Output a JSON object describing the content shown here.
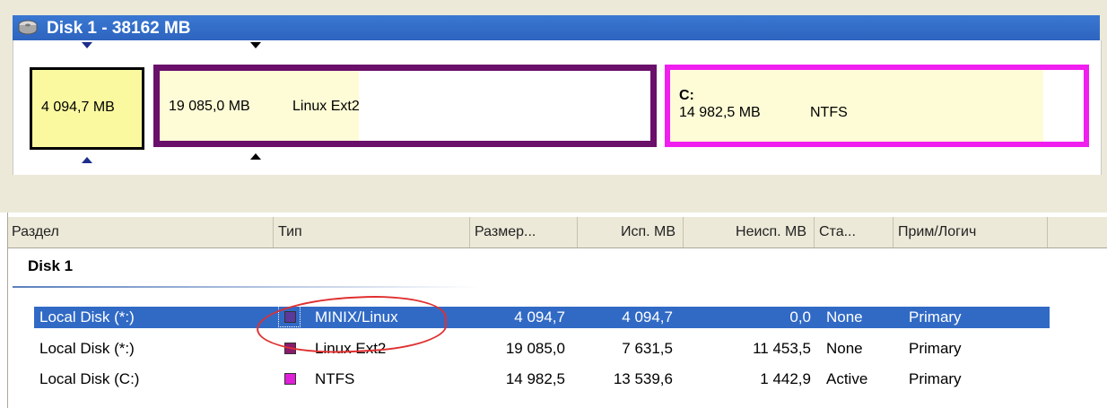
{
  "disk": {
    "title": "Disk 1 - 38162 MB",
    "icon": "hard-disk-icon"
  },
  "partitions_map": [
    {
      "size": "4 094,7 MB",
      "fs": "",
      "letter": "",
      "border_color": "#000000"
    },
    {
      "size": "19 085,0 MB",
      "fs": "Linux Ext2",
      "letter": "",
      "border_color": "#6a0f6a"
    },
    {
      "size": "14 982,5 MB",
      "fs": "NTFS",
      "letter": "C:",
      "border_color": "#f01ff0"
    }
  ],
  "table": {
    "columns": [
      "Раздел",
      "Тип",
      "Размер...",
      "Исп. MB",
      "Неисп. MB",
      "Ста...",
      "Прим/Логич"
    ],
    "group": "Disk 1",
    "rows": [
      {
        "name": "Local Disk (*:)",
        "type": "MINIX/Linux",
        "type_color": "#5a3a9c",
        "size": "4 094,7",
        "used": "4 094,7",
        "unused": "0,0",
        "status": "None",
        "kind": "Primary",
        "selected": true
      },
      {
        "name": "Local Disk (*:)",
        "type": "Linux Ext2",
        "type_color": "#8b1a6e",
        "size": "19 085,0",
        "used": "7 631,5",
        "unused": "11 453,5",
        "status": "None",
        "kind": "Primary",
        "selected": false
      },
      {
        "name": "Local Disk (C:)",
        "type": "NTFS",
        "type_color": "#e020d8",
        "size": "14 982,5",
        "used": "13 539,6",
        "unused": "1 442,9",
        "status": "Active",
        "kind": "Primary",
        "selected": false
      }
    ]
  },
  "colors": {
    "header_blue": "#2d64bf",
    "selection": "#316ac5",
    "annotation": "#e03030"
  }
}
